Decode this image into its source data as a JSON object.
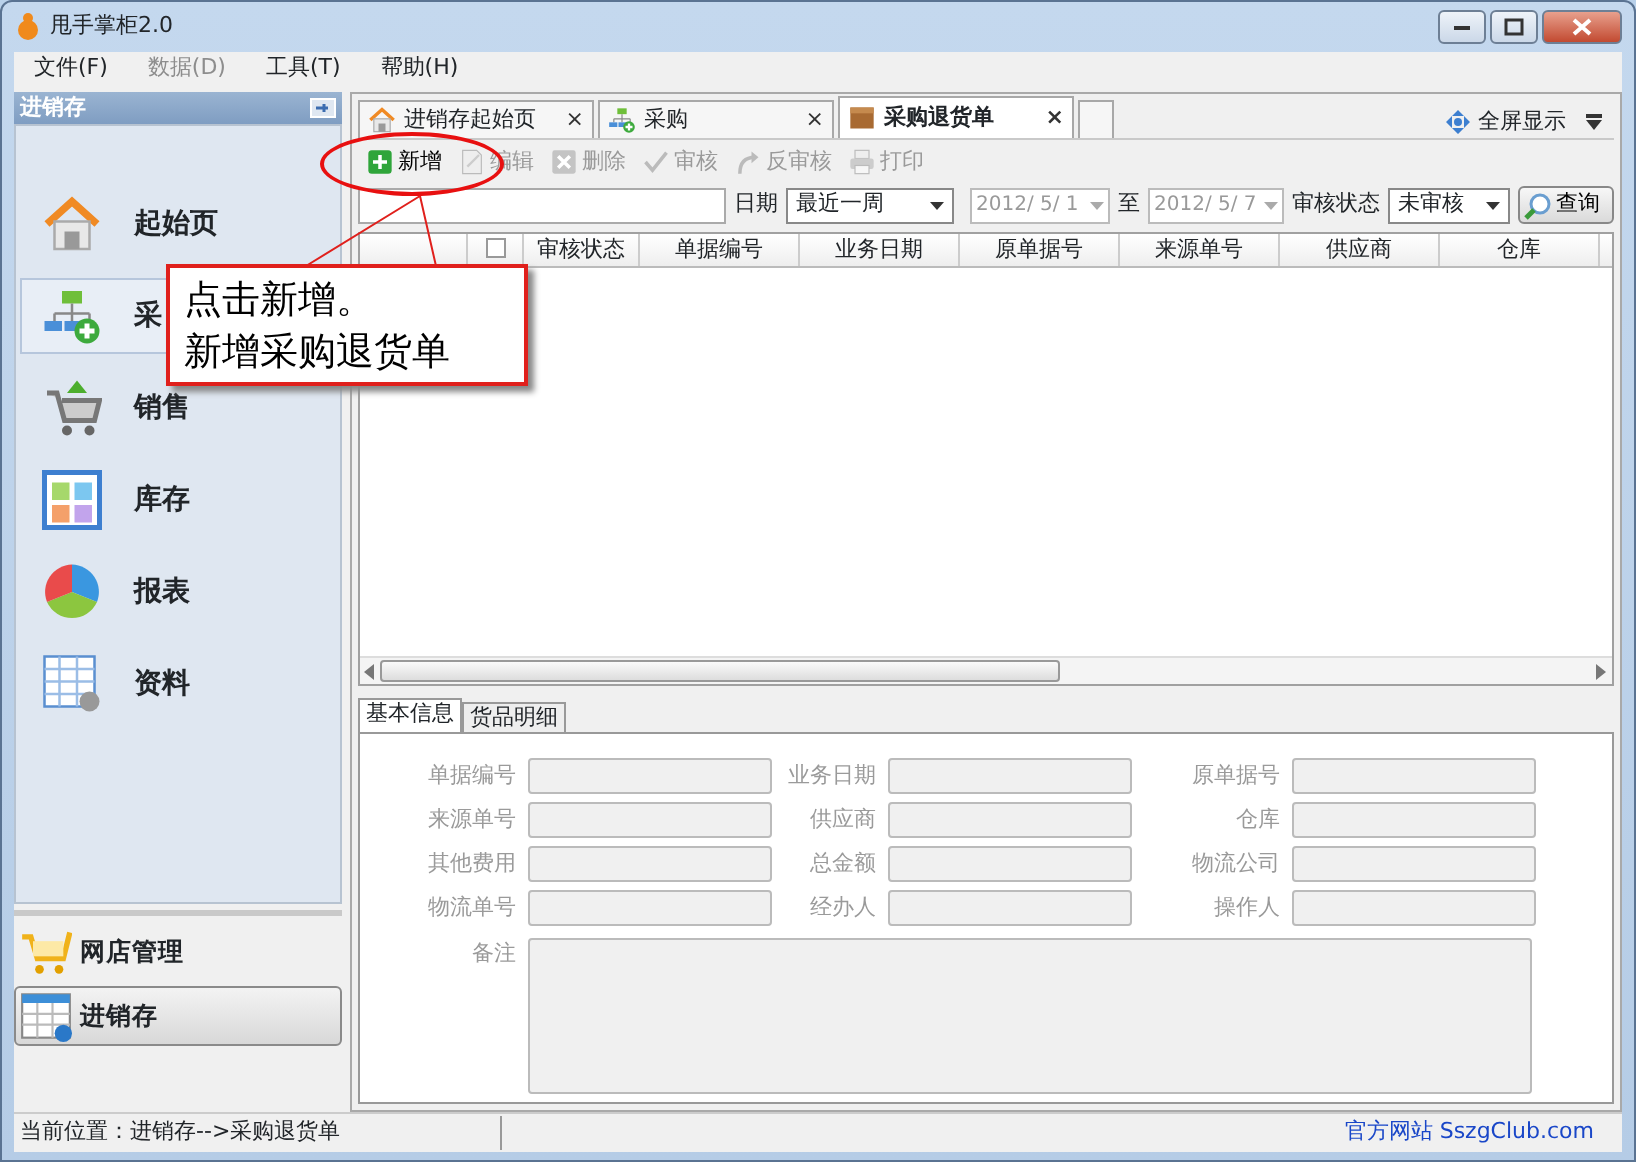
{
  "window": {
    "title": "甩手掌柜2.0"
  },
  "menu": [
    {
      "label": "文件(F)",
      "disabled": false
    },
    {
      "label": "数据(D)",
      "disabled": true
    },
    {
      "label": "工具(T)",
      "disabled": false
    },
    {
      "label": "帮助(H)",
      "disabled": false
    }
  ],
  "sidebar": {
    "title": "进销存",
    "items": [
      {
        "label": "起始页",
        "kind": "home",
        "selected": false
      },
      {
        "label": "采",
        "kind": "flow",
        "selected": true
      },
      {
        "label": "销售",
        "kind": "cart",
        "selected": false
      },
      {
        "label": "库存",
        "kind": "grid",
        "selected": false
      },
      {
        "label": "报表",
        "kind": "pie",
        "selected": false
      },
      {
        "label": "资料",
        "kind": "sheet",
        "selected": false
      }
    ],
    "modules": [
      {
        "label": "网店管理",
        "kind": "shop",
        "selected": false
      },
      {
        "label": "进销存",
        "kind": "table",
        "selected": true
      }
    ]
  },
  "tabs": [
    {
      "label": "进销存起始页",
      "kind": "home",
      "close": "×",
      "selected": false
    },
    {
      "label": "采购",
      "kind": "flow",
      "close": "×",
      "selected": false
    },
    {
      "label": "采购退货单",
      "kind": "box",
      "close": "×",
      "selected": true
    }
  ],
  "fullscreen": "全屏显示",
  "toolbar": [
    {
      "label": "新增",
      "kind": "add",
      "disabled": false
    },
    {
      "label": "编辑",
      "kind": "edit",
      "disabled": true
    },
    {
      "label": "删除",
      "kind": "delete",
      "disabled": true
    },
    {
      "label": "审核",
      "kind": "check",
      "disabled": true
    },
    {
      "label": "反审核",
      "kind": "undo",
      "disabled": true
    },
    {
      "label": "打印",
      "kind": "print",
      "disabled": true
    }
  ],
  "filter": {
    "date_label": "日期",
    "period": "最近一周",
    "from": "2012/ 5/ 1",
    "to_label": "至",
    "to": "2012/ 5/ 7",
    "status_label": "审核状态",
    "status": "未审核",
    "query": "查询"
  },
  "grid": {
    "select_all_checked": false,
    "columns": [
      "审核状态",
      "单据编号",
      "业务日期",
      "原单据号",
      "来源单号",
      "供应商",
      "仓库"
    ]
  },
  "detail_tabs": [
    {
      "label": "基本信息",
      "selected": true
    },
    {
      "label": "货品明细",
      "selected": false
    }
  ],
  "fields": [
    {
      "label": "单据编号"
    },
    {
      "label": "业务日期"
    },
    {
      "label": "原单据号"
    },
    {
      "label": "来源单号"
    },
    {
      "label": "供应商"
    },
    {
      "label": "仓库"
    },
    {
      "label": "其他费用"
    },
    {
      "label": "总金额"
    },
    {
      "label": "物流公司"
    },
    {
      "label": "物流单号"
    },
    {
      "label": "经办人"
    },
    {
      "label": "操作人"
    }
  ],
  "remarks_label": "备注",
  "status_bar": {
    "location": "当前位置：进销存-->采购退货单",
    "website": "官方网站 SszgClub.com"
  },
  "callout": {
    "lines": [
      "点击新增。",
      "新增采购退货单"
    ]
  }
}
